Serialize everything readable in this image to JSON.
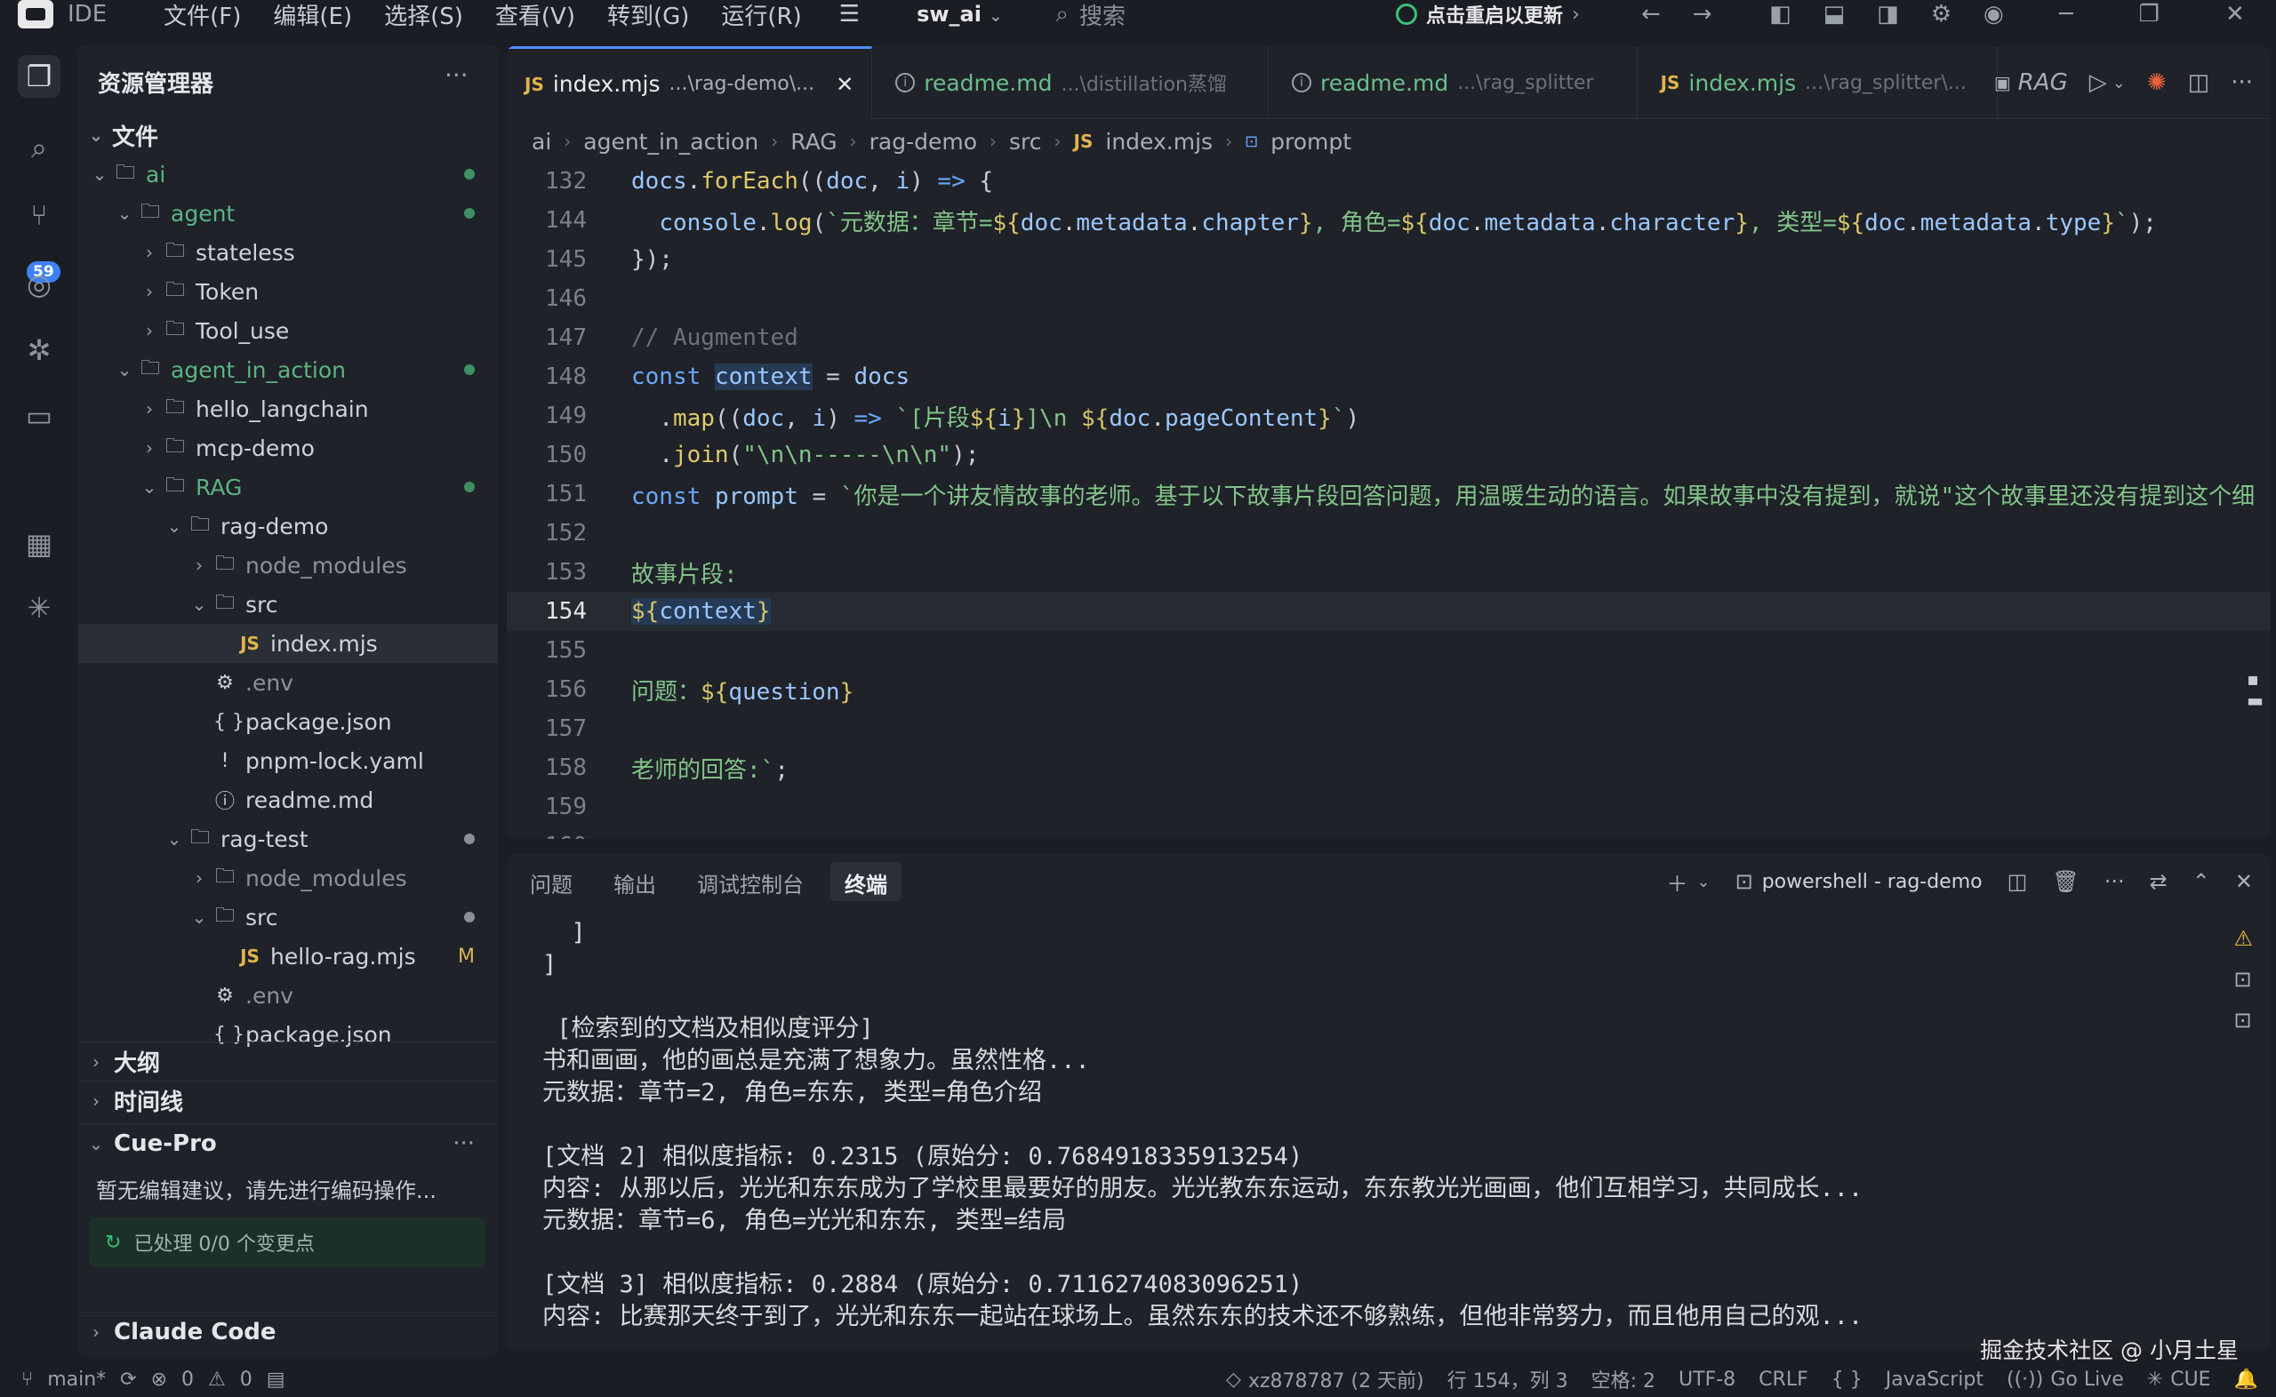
{
  "titlebar": {
    "app": "IDE",
    "menus": [
      "文件(F)",
      "编辑(E)",
      "选择(S)",
      "查看(V)",
      "转到(G)",
      "运行(R)"
    ],
    "project": "sw_ai",
    "search_placeholder": "搜索",
    "update_label": "点击重启以更新"
  },
  "activity": {
    "scm_badge": "59"
  },
  "sidebar": {
    "title": "资源管理器",
    "root": "文件",
    "tree": [
      {
        "label": "ai",
        "depth": 0,
        "kind": "folder",
        "open": true,
        "color": "green",
        "mark": "dot-green"
      },
      {
        "label": "agent",
        "depth": 1,
        "kind": "folder",
        "open": true,
        "color": "green",
        "mark": "dot-green"
      },
      {
        "label": "stateless",
        "depth": 2,
        "kind": "folder",
        "open": false
      },
      {
        "label": "Token",
        "depth": 2,
        "kind": "folder",
        "open": false
      },
      {
        "label": "Tool_use",
        "depth": 2,
        "kind": "folder",
        "open": false
      },
      {
        "label": "agent_in_action",
        "depth": 1,
        "kind": "folder",
        "open": true,
        "color": "green",
        "mark": "dot-green"
      },
      {
        "label": "hello_langchain",
        "depth": 2,
        "kind": "folder",
        "open": false
      },
      {
        "label": "mcp-demo",
        "depth": 2,
        "kind": "folder",
        "open": false
      },
      {
        "label": "RAG",
        "depth": 2,
        "kind": "folder",
        "open": true,
        "color": "green",
        "mark": "dot-green"
      },
      {
        "label": "rag-demo",
        "depth": 3,
        "kind": "folder",
        "open": true
      },
      {
        "label": "node_modules",
        "depth": 4,
        "kind": "folder",
        "open": false,
        "color": "dim"
      },
      {
        "label": "src",
        "depth": 4,
        "kind": "folder",
        "open": true
      },
      {
        "label": "index.mjs",
        "depth": 5,
        "kind": "js",
        "selected": true
      },
      {
        "label": ".env",
        "depth": 4,
        "kind": "gear",
        "color": "dim"
      },
      {
        "label": "package.json",
        "depth": 4,
        "kind": "json"
      },
      {
        "label": "pnpm-lock.yaml",
        "depth": 4,
        "kind": "yaml"
      },
      {
        "label": "readme.md",
        "depth": 4,
        "kind": "info"
      },
      {
        "label": "rag-test",
        "depth": 3,
        "kind": "folder",
        "open": true,
        "mark": "dot-gray"
      },
      {
        "label": "node_modules",
        "depth": 4,
        "kind": "folder",
        "open": false,
        "color": "dim"
      },
      {
        "label": "src",
        "depth": 4,
        "kind": "folder",
        "open": true,
        "mark": "dot-gray"
      },
      {
        "label": "hello-rag.mjs",
        "depth": 5,
        "kind": "js",
        "mark": "M"
      },
      {
        "label": ".env",
        "depth": 4,
        "kind": "gear",
        "color": "dim"
      },
      {
        "label": "package.json",
        "depth": 4,
        "kind": "json"
      }
    ],
    "sections": {
      "outline": "大纲",
      "timeline": "时间线",
      "cue": "Cue-Pro",
      "claude": "Claude Code"
    },
    "cue_message": "暂无编辑建议，请先进行编码操作...",
    "cue_status": "已处理 0/0 个变更点"
  },
  "tabs": [
    {
      "label": "index.mjs",
      "hint": "...\\rag-demo\\...",
      "type": "js",
      "active": true
    },
    {
      "label": "readme.md",
      "hint": "...\\distillation蒸馏",
      "type": "info"
    },
    {
      "label": "readme.md",
      "hint": "...\\rag_splitter",
      "type": "info"
    },
    {
      "label": "index.mjs",
      "hint": "...\\rag_splitter\\...",
      "type": "js"
    }
  ],
  "tab_actions": {
    "run_config": "RAG"
  },
  "breadcrumb": [
    "ai",
    "agent_in_action",
    "RAG",
    "rag-demo",
    "src",
    "index.mjs",
    "prompt"
  ],
  "code_lines": [
    {
      "n": "132",
      "html": "<span class='v'>docs</span><span class='o'>.</span><span class='f'>forEach</span><span class='o'>((</span><span class='v'>doc</span><span class='o'>, </span><span class='v'>i</span><span class='o'>) </span><span class='k'>=></span><span class='o'> {</span>"
    },
    {
      "n": "144",
      "html": "  <span class='v'>console</span><span class='o'>.</span><span class='f'>log</span><span class='o'>(</span><span class='s'>`元数据：章节=</span><span class='p'>${</span><span class='v'>doc</span><span class='o'>.</span><span class='v'>metadata</span><span class='o'>.</span><span class='v'>chapter</span><span class='p'>}</span><span class='s'>, 角色=</span><span class='p'>${</span><span class='v'>doc</span><span class='o'>.</span><span class='v'>metadata</span><span class='o'>.</span><span class='v'>character</span><span class='p'>}</span><span class='s'>, 类型=</span><span class='p'>${</span><span class='v'>doc</span><span class='o'>.</span><span class='v'>metadata</span><span class='o'>.</span><span class='v'>type</span><span class='p'>}</span><span class='s'>`</span><span class='o'>);</span>"
    },
    {
      "n": "145",
      "html": "<span class='o'>});</span>"
    },
    {
      "n": "146",
      "html": ""
    },
    {
      "n": "147",
      "html": "<span class='c'>// Augmented</span>"
    },
    {
      "n": "148",
      "html": "<span class='k'>const</span> <span class='v hl'>context</span><span class='o'> = </span><span class='v'>docs</span>"
    },
    {
      "n": "149",
      "html": "  <span class='o'>.</span><span class='f'>map</span><span class='o'>((</span><span class='v'>doc</span><span class='o'>, </span><span class='v'>i</span><span class='o'>) </span><span class='k'>=></span><span class='o'> </span><span class='s'>`[片段</span><span class='p'>${</span><span class='v'>i</span><span class='p'>}</span><span class='s'>]\\n </span><span class='p'>${</span><span class='v'>doc</span><span class='o'>.</span><span class='v'>pageContent</span><span class='p'>}</span><span class='s'>`</span><span class='o'>)</span>"
    },
    {
      "n": "150",
      "html": "  <span class='o'>.</span><span class='f'>join</span><span class='o'>(</span><span class='s'>\"\\n\\n-----\\n\\n\"</span><span class='o'>);</span>"
    },
    {
      "n": "151",
      "html": "<span class='k'>const</span> <span class='v'>prompt</span><span class='o'> = </span><span class='s'>`你是一个讲友情故事的老师。基于以下故事片段回答问题，用温暖生动的语言。如果故事中没有提到，就说\"这个故事里还没有提到这个细</span>"
    },
    {
      "n": "152",
      "html": ""
    },
    {
      "n": "153",
      "html": "<span class='s'>故事片段:</span>"
    },
    {
      "n": "154",
      "html": "<span class='p hl'>${</span><span class='v hl'>context</span><span class='p hl'>}</span>",
      "current": true
    },
    {
      "n": "155",
      "html": ""
    },
    {
      "n": "156",
      "html": "<span class='s'>问题：</span><span class='p'>${</span><span class='v'>question</span><span class='p'>}</span>"
    },
    {
      "n": "157",
      "html": ""
    },
    {
      "n": "158",
      "html": "<span class='s'>老师的回答:`</span><span class='o'>;</span>"
    },
    {
      "n": "159",
      "html": ""
    },
    {
      "n": "160",
      "html": ""
    }
  ],
  "panel": {
    "tabs": [
      "问题",
      "输出",
      "调试控制台",
      "终端"
    ],
    "active_tab": "终端",
    "terminal_name": "powershell - rag-demo",
    "lines": [
      "  ]",
      "]",
      "",
      " [检索到的文档及相似度评分]",
      "书和画画，他的画总是充满了想象力。虽然性格...",
      "元数据：章节=2, 角色=东东, 类型=角色介绍",
      "",
      "[文档 2] 相似度指标: 0.2315 (原始分: 0.7684918335913254)",
      "内容: 从那以后，光光和东东成为了学校里最要好的朋友。光光教东东运动，东东教光光画画，他们互相学习，共同成长...",
      "元数据：章节=6, 角色=光光和东东, 类型=结局",
      "",
      "[文档 3] 相似度指标: 0.2884 (原始分: 0.7116274083096251)",
      "内容: 比赛那天终于到了，光光和东东一起站在球场上。虽然东东的技术还不够熟练，但他非常努力，而且他用自己的观..."
    ]
  },
  "statusbar": {
    "branch": "main*",
    "errors": "0",
    "warnings": "0",
    "blame": "xz878787 (2 天前)",
    "position": "行 154，列 3",
    "indent": "空格: 2",
    "encoding": "UTF-8",
    "eol": "CRLF",
    "language": "JavaScript",
    "golive": "Go Live",
    "cue": "CUE"
  },
  "watermark": "掘金技术社区 @ 小月土星"
}
